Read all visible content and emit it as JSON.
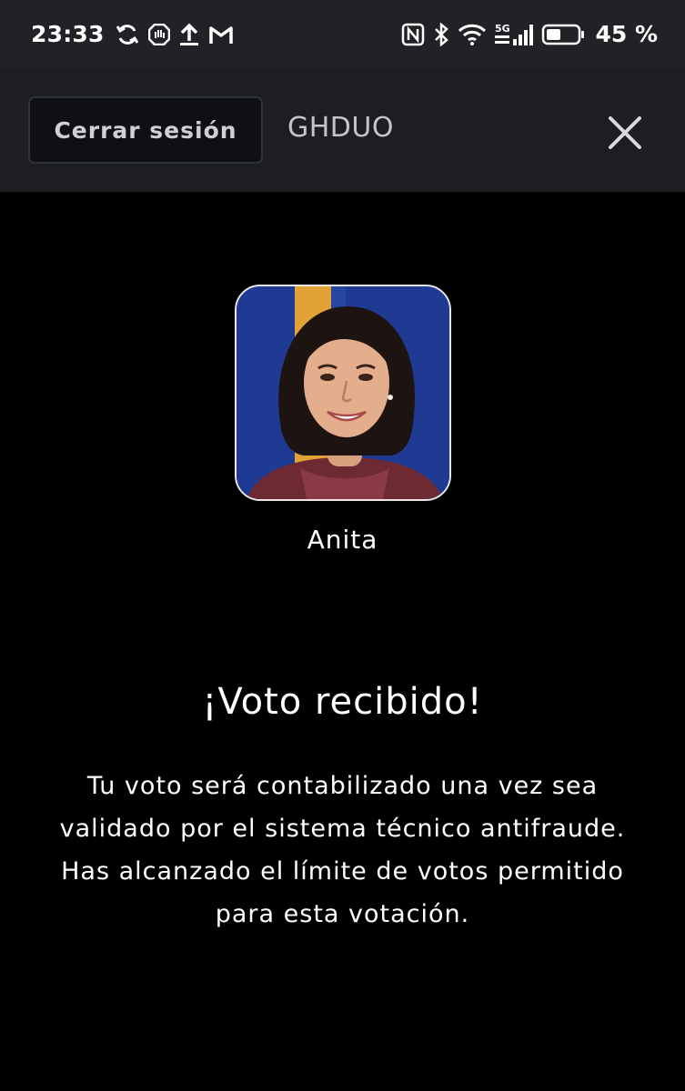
{
  "status_bar": {
    "time": "23:33",
    "battery_percent": "45 %",
    "left_icons": [
      "sync-icon",
      "hand-stop-icon",
      "upload-icon",
      "gmail-icon"
    ],
    "right_icons": [
      "nfc-icon",
      "bluetooth-icon",
      "wifi-icon",
      "5g-signal-icon",
      "battery-icon"
    ],
    "network_label": "5G"
  },
  "header": {
    "logout_label": "Cerrar sesión",
    "title": "GHDUO",
    "close_icon": "close-icon"
  },
  "contestant": {
    "name": "Anita",
    "photo_background_colors": [
      "#1f3a93",
      "#e3a238"
    ]
  },
  "confirmation": {
    "heading": "¡Voto recibido!",
    "message": "Tu voto será contabilizado una vez sea validado por el sistema técnico antifraude. Has alcanzado el límite de votos permitido para esta votación."
  },
  "colors": {
    "status_bar_bg": "#202226",
    "header_bg": "#1c1e22",
    "page_bg": "#000000",
    "button_bg": "#0f1013"
  }
}
